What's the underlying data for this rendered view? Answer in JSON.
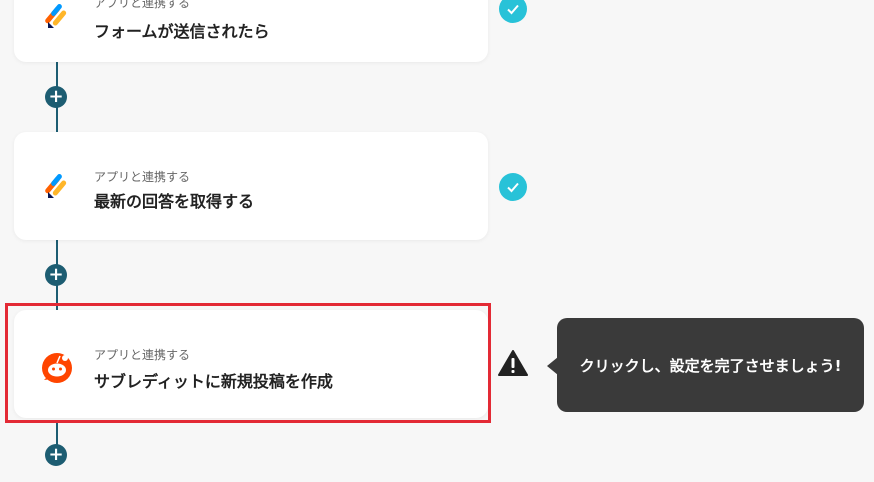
{
  "steps": [
    {
      "caption": "アプリと連携する",
      "title": "フォームが送信されたら",
      "status": "complete"
    },
    {
      "caption": "アプリと連携する",
      "title": "最新の回答を取得する",
      "status": "complete"
    },
    {
      "caption": "アプリと連携する",
      "title": "サブレディットに新規投稿を作成",
      "status": "warning"
    }
  ],
  "add_step_symbol": "+",
  "tooltip": {
    "text": "クリックし、設定を完了させましょう!"
  },
  "colors": {
    "accent": "#1d5d72",
    "check": "#28c2d8",
    "highlight": "#e32a35",
    "reddit": "#ff4500"
  }
}
